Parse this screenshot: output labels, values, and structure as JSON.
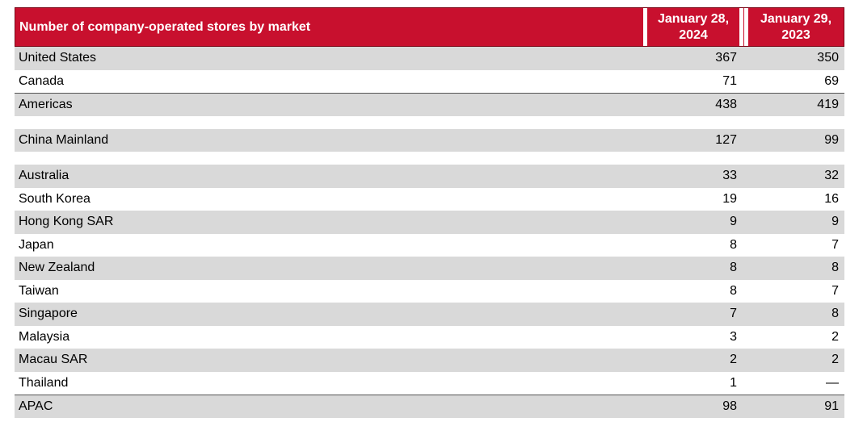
{
  "table": {
    "title": "Number of company-operated stores by market",
    "col1_line1": "January 28,",
    "col1_line2": "2024",
    "col2_line1": "January 29,",
    "col2_line2": "2023",
    "rows": [
      {
        "label": "United States",
        "v1": "367",
        "v2": "350"
      },
      {
        "label": "Canada",
        "v1": "71",
        "v2": "69"
      },
      {
        "label": "Americas",
        "v1": "438",
        "v2": "419"
      },
      {
        "label": "China Mainland",
        "v1": "127",
        "v2": "99"
      },
      {
        "label": "Australia",
        "v1": "33",
        "v2": "32"
      },
      {
        "label": "South Korea",
        "v1": "19",
        "v2": "16"
      },
      {
        "label": "Hong Kong SAR",
        "v1": "9",
        "v2": "9"
      },
      {
        "label": "Japan",
        "v1": "8",
        "v2": "7"
      },
      {
        "label": "New Zealand",
        "v1": "8",
        "v2": "8"
      },
      {
        "label": "Taiwan",
        "v1": "8",
        "v2": "7"
      },
      {
        "label": "Singapore",
        "v1": "7",
        "v2": "8"
      },
      {
        "label": "Malaysia",
        "v1": "3",
        "v2": "2"
      },
      {
        "label": "Macau SAR",
        "v1": "2",
        "v2": "2"
      },
      {
        "label": "Thailand",
        "v1": "1",
        "v2": "—"
      },
      {
        "label": "APAC",
        "v1": "98",
        "v2": "91"
      }
    ]
  },
  "colors": {
    "header_bg": "#c8102e",
    "alt_row_bg": "#d9d9d9"
  }
}
